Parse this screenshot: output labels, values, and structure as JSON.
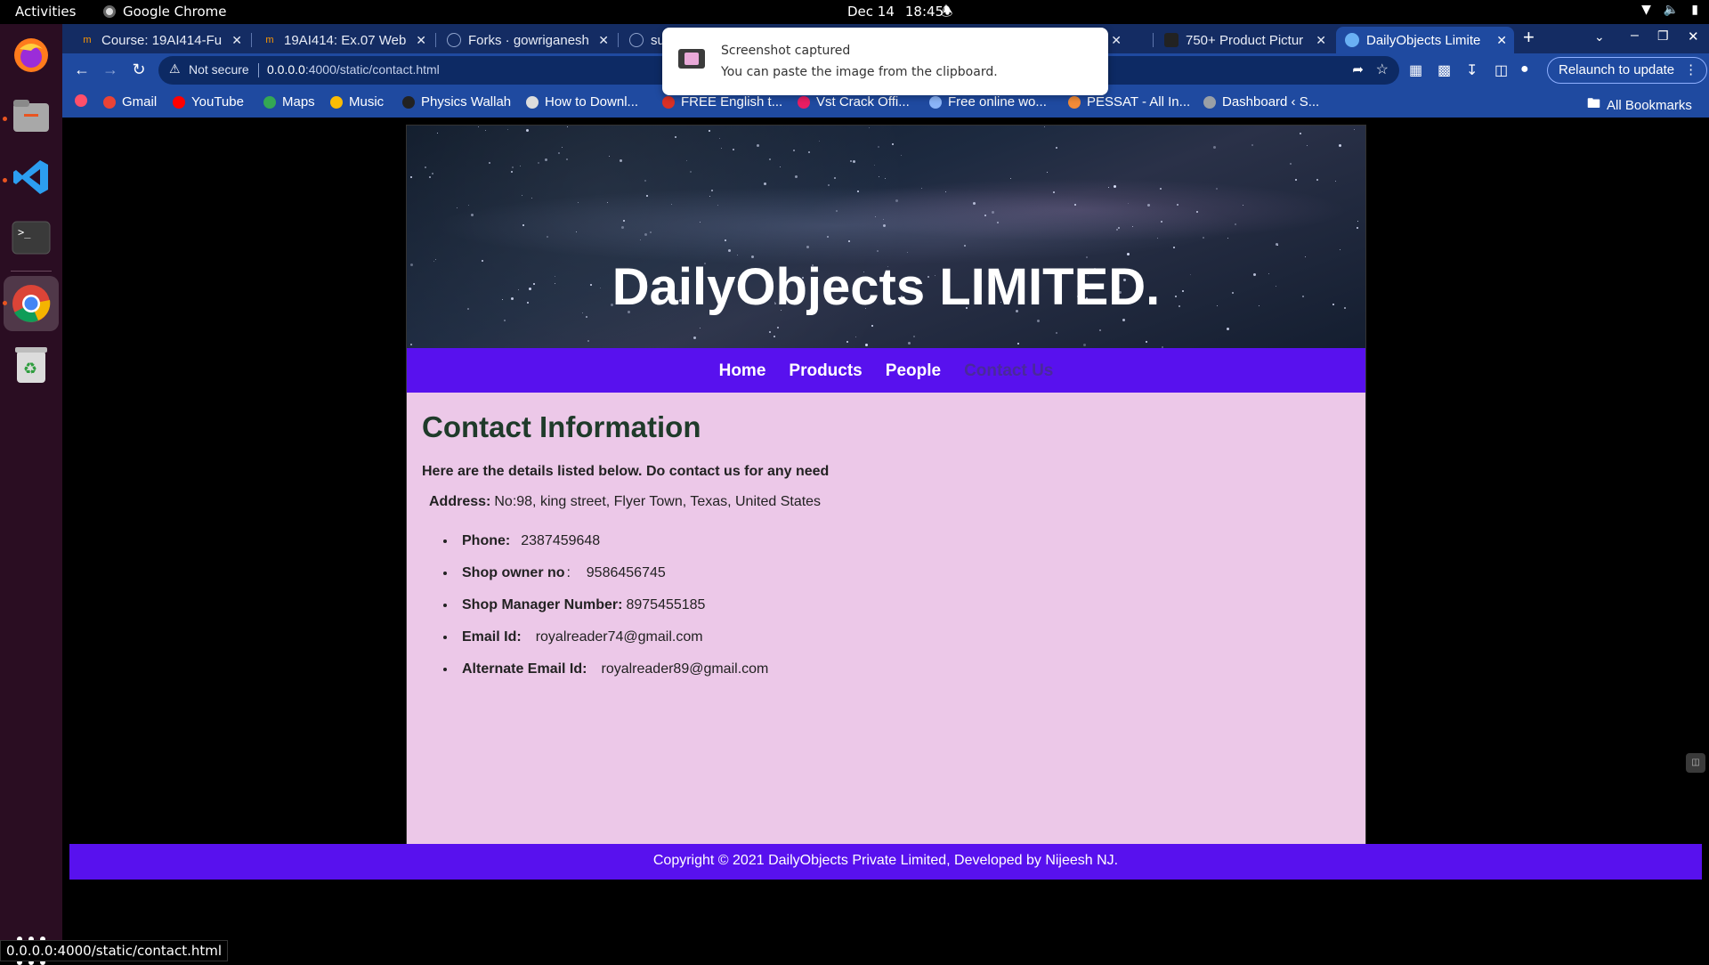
{
  "os": {
    "activities": "Activities",
    "app_name": "Google Chrome",
    "date": "Dec 14",
    "time": "18:45"
  },
  "tabs": [
    {
      "title": "Course: 19AI414-Fu"
    },
    {
      "title": "19AI414: Ex.07 Web"
    },
    {
      "title": "Forks · gowriganesh"
    },
    {
      "title": "sur"
    },
    {
      "title": "750+ Product Pictur"
    },
    {
      "title": "DailyObjects Limite",
      "active": true
    }
  ],
  "omnibox": {
    "security": "Not secure",
    "host": "0.0.0.0",
    "path": ":4000/static/contact.html"
  },
  "toolbar": {
    "relaunch_label": "Relaunch to update"
  },
  "bookmarks": [
    {
      "label": "Gmail",
      "color": "#ea4335"
    },
    {
      "label": "YouTube",
      "color": "#ff0000"
    },
    {
      "label": "Maps",
      "color": "#34a853"
    },
    {
      "label": "Music",
      "color": "#fbbc04"
    },
    {
      "label": "Physics Wallah",
      "color": "#222222"
    },
    {
      "label": "How to Downl...",
      "color": "#dddddd"
    },
    {
      "label": "FREE English t...",
      "color": "#d93025"
    },
    {
      "label": "Vst Crack Offi...",
      "color": "#e91e63"
    },
    {
      "label": "Free online wo...",
      "color": "#8ab4f8"
    },
    {
      "label": "PESSAT - All In...",
      "color": "#f28b38"
    },
    {
      "label": "Dashboard ‹ S...",
      "color": "#9aa0a6"
    }
  ],
  "all_bookmarks": "All Bookmarks",
  "notification": {
    "title": "Screenshot captured",
    "body": "You can paste the image from the clipboard."
  },
  "site": {
    "title": "DailyObjects LIMITED.",
    "nav": [
      "Home",
      "Products",
      "People",
      "Contact Us"
    ],
    "nav_current": "Contact Us",
    "heading": "Contact Information",
    "intro": "Here are the details listed below. Do contact us for any need",
    "address_label": "Address:",
    "address_value": "No:98, king street, Flyer Town, Texas, United States",
    "contacts": [
      {
        "label": "Phone:",
        "value": "2387459648"
      },
      {
        "label": "Shop owner no",
        "value": ":    9586456745"
      },
      {
        "label": "Shop Manager Number:",
        "value": "8975455185"
      },
      {
        "label": "Email Id:",
        "value": "royalreader74@gmail.com"
      },
      {
        "label": "Alternate Email Id:",
        "value": "royalreader89@gmail.com"
      }
    ],
    "footer": "Copyright © 2021 DailyObjects Private Limited, Developed by Nijeesh NJ."
  },
  "status_url": "0.0.0.0:4000/static/contact.html",
  "colors": {
    "nav_bg": "#5811ee",
    "content_bg": "#ecc8e8",
    "chrome_tabstrip": "#142c63",
    "chrome_toolbar": "#1f4aa0"
  }
}
